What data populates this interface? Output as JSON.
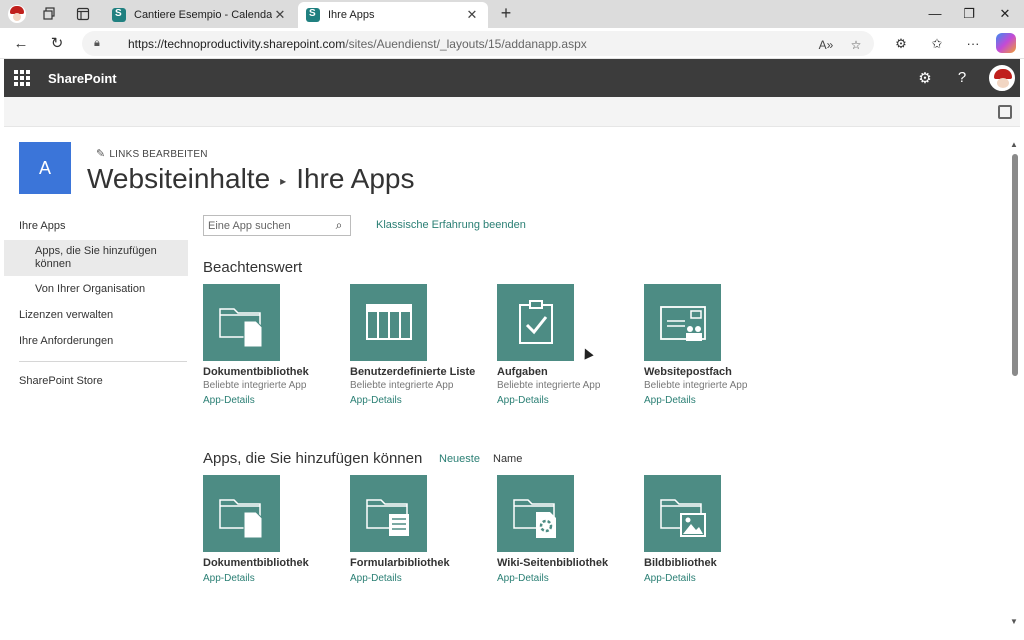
{
  "browser": {
    "tabs": [
      {
        "title": "Cantiere Esempio - Calendario",
        "active": false
      },
      {
        "title": "Ihre Apps",
        "active": true
      }
    ],
    "url_host": "https://technoproductivity.sharepoint.com",
    "url_path": "/sites/Auendienst/_layouts/15/addanapp.aspx",
    "window_controls": {
      "minimize": "—",
      "maximize": "❐",
      "close": "✕"
    },
    "new_tab": "+"
  },
  "suitebar": {
    "brand": "SharePoint"
  },
  "site": {
    "logo_letter": "A",
    "edit_links": "LINKS BEARBEITEN",
    "title_parent": "Websiteinhalte",
    "title_current": "Ihre Apps"
  },
  "leftnav": {
    "items": [
      {
        "label": "Ihre Apps",
        "sub": false,
        "selected": false
      },
      {
        "label": "Apps, die Sie hinzufügen können",
        "sub": true,
        "selected": true
      },
      {
        "label": "Von Ihrer Organisation",
        "sub": true,
        "selected": false
      },
      {
        "label": "Lizenzen verwalten",
        "sub": false,
        "selected": false
      },
      {
        "label": "Ihre Anforderungen",
        "sub": false,
        "selected": false
      }
    ],
    "store": "SharePoint Store"
  },
  "search": {
    "placeholder": "Eine App suchen"
  },
  "classic_link": "Klassische Erfahrung beenden",
  "noteworthy": {
    "title": "Beachtenswert",
    "tiles": [
      {
        "name": "Dokumentbibliothek",
        "desc": "Beliebte integrierte App",
        "link": "App-Details",
        "icon": "document-library-icon"
      },
      {
        "name": "Benutzerdefinierte Liste",
        "desc": "Beliebte integrierte App",
        "link": "App-Details",
        "icon": "custom-list-icon"
      },
      {
        "name": "Aufgaben",
        "desc": "Beliebte integrierte App",
        "link": "App-Details",
        "icon": "tasks-icon"
      },
      {
        "name": "Websitepostfach",
        "desc": "Beliebte integrierte App",
        "link": "App-Details",
        "icon": "site-mailbox-icon"
      }
    ]
  },
  "addable": {
    "title": "Apps, die Sie hinzufügen können",
    "sort_newest": "Neueste",
    "sort_name": "Name",
    "tiles": [
      {
        "name": "Dokumentbibliothek",
        "link": "App-Details",
        "icon": "document-library-icon"
      },
      {
        "name": "Formularbibliothek",
        "link": "App-Details",
        "icon": "form-library-icon"
      },
      {
        "name": "Wiki-Seitenbibliothek",
        "link": "App-Details",
        "icon": "wiki-library-icon"
      },
      {
        "name": "Bildbibliothek",
        "link": "App-Details",
        "icon": "picture-library-icon"
      }
    ]
  },
  "colors": {
    "tile": "#4d8c84",
    "link": "#2a7f74",
    "suitebar": "#3c3c3c",
    "site_logo": "#3b75d9"
  }
}
